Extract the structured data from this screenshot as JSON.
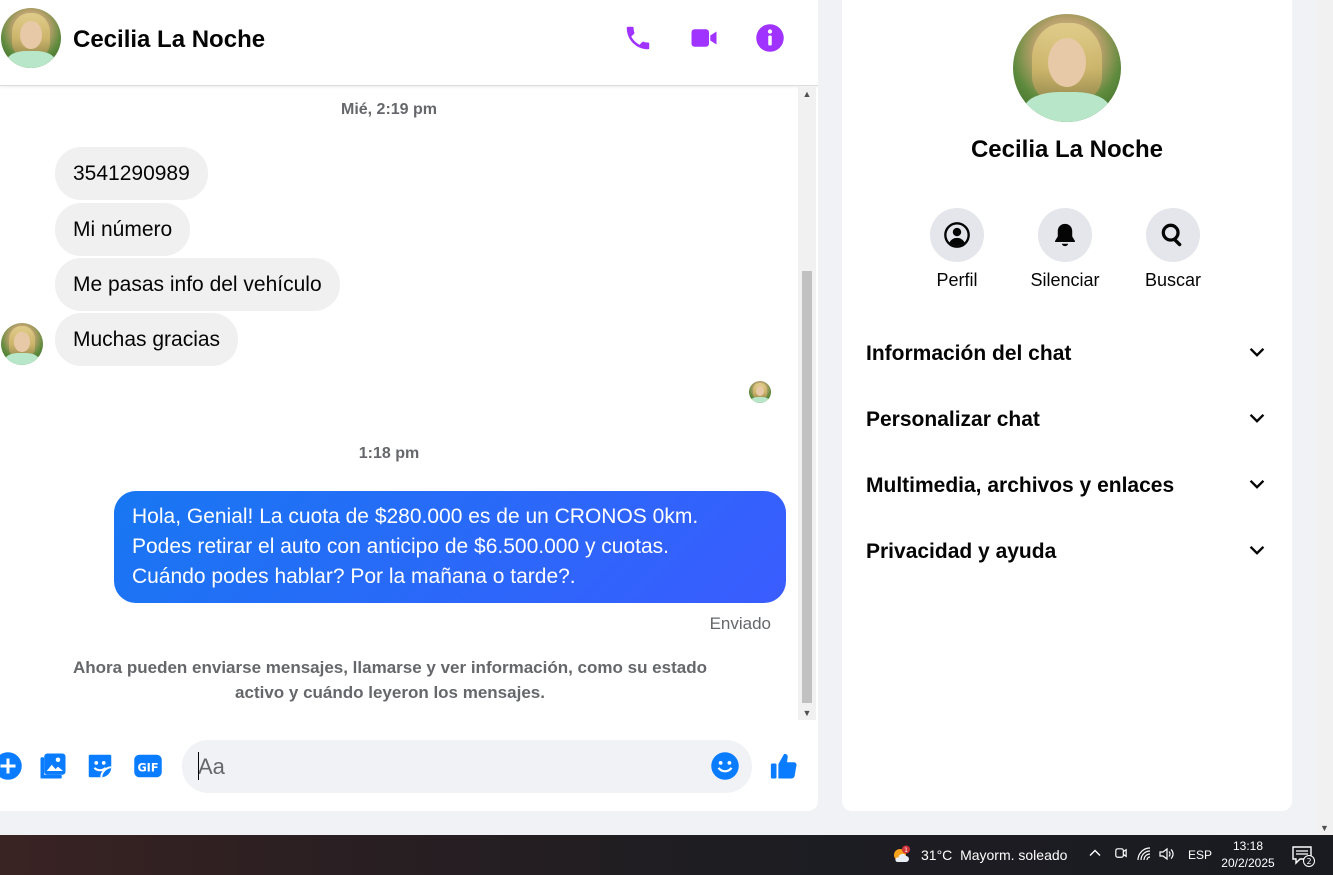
{
  "contact": {
    "name": "Cecilia La Noche"
  },
  "header": {
    "call_icon": "phone-icon",
    "video_icon": "video-camera-icon",
    "info_icon": "info-icon"
  },
  "messages": {
    "timestamp_1": "Mié, 2:19 pm",
    "incoming": [
      "3541290989",
      "Mi número",
      "Me pasas info del vehículo",
      "Muchas gracias"
    ],
    "timestamp_2": "1:18 pm",
    "outgoing": [
      "Hola, Genial! La cuota de $280.000 es de un CRONOS 0km.",
      "Podes retirar el auto con anticipo de $6.500.000 y cuotas.",
      "Cuándo podes hablar? Por la mañana o tarde?."
    ],
    "status": "Enviado",
    "info_note_line1": "Ahora pueden enviarse mensajes, llamarse y ver información, como su estado",
    "info_note_line2": "activo y cuándo leyeron los mensajes."
  },
  "composer": {
    "placeholder": "Aa",
    "icons": [
      "plus-icon",
      "image-icon",
      "sticker-icon",
      "gif-icon",
      "emoji-icon",
      "thumbs-up-icon"
    ]
  },
  "info_panel": {
    "actions": [
      {
        "label": "Perfil",
        "icon": "profile-icon"
      },
      {
        "label": "Silenciar",
        "icon": "bell-icon"
      },
      {
        "label": "Buscar",
        "icon": "search-icon"
      }
    ],
    "sections": [
      "Información del chat",
      "Personalizar chat",
      "Multimedia, archivos y enlaces",
      "Privacidad y ayuda"
    ]
  },
  "taskbar": {
    "weather_badge": "1",
    "temperature": "31°C",
    "weather": "Mayorm. soleado",
    "language": "ESP",
    "time": "13:18",
    "date": "20/2/2025",
    "notifications": "2"
  },
  "colors": {
    "accent_purple": "#a033ff",
    "messenger_blue": "#0a7cff",
    "bubble_out_start": "#1877f2",
    "bubble_out_end": "#3a5cff"
  }
}
